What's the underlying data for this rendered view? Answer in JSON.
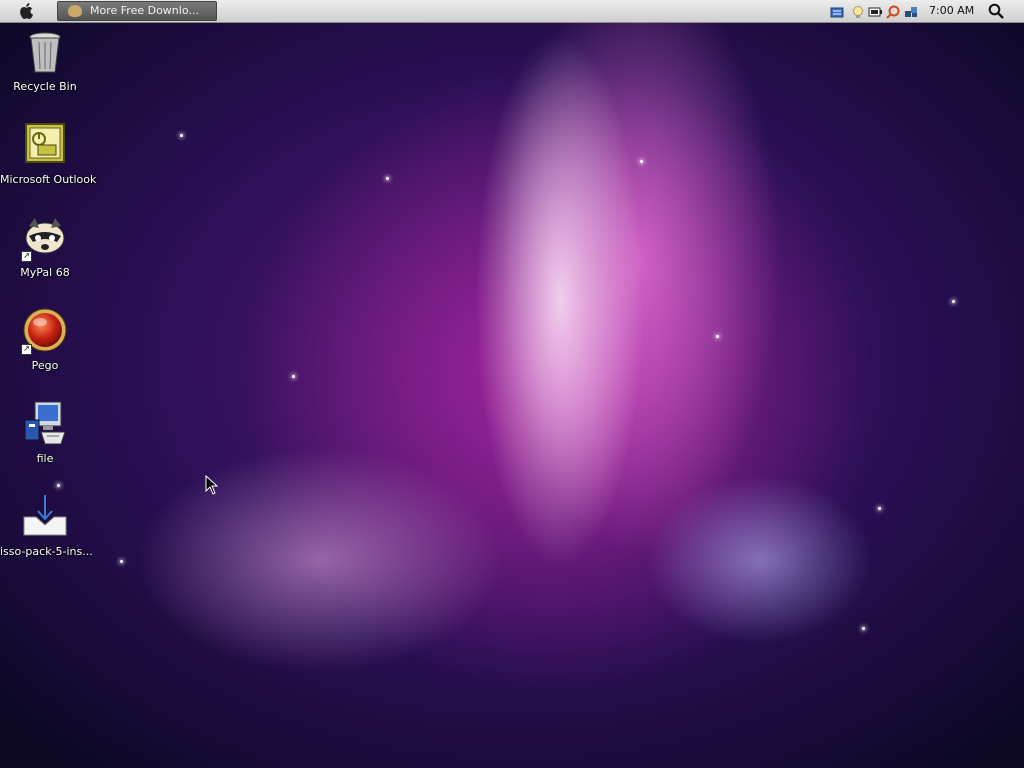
{
  "menubar": {
    "apple_icon": "apple-logo-icon",
    "task_button": {
      "label": "More Free Downlo...",
      "icon": "raccoon-icon"
    },
    "tray_icons": [
      "keyboard-icon",
      "lightbulb-icon",
      "battery-icon",
      "search-magnifier-icon",
      "network-icon"
    ],
    "clock": "7:00 AM",
    "spotlight_icon": "spotlight-search-icon"
  },
  "desktop_icons": [
    {
      "label": "Recycle Bin",
      "icon": "recycle-bin-icon"
    },
    {
      "label": "Microsoft Outlook",
      "icon": "outlook-icon"
    },
    {
      "label": "MyPal 68",
      "icon": "mypal-raccoon-icon"
    },
    {
      "label": "Pego",
      "icon": "pego-icon"
    },
    {
      "label": "file",
      "icon": "installer-file-icon"
    },
    {
      "label": "isso-pack-5-ins...",
      "icon": "download-package-icon"
    }
  ],
  "colors": {
    "menubar_top": "#ececec",
    "menubar_bottom": "#cfcfcf",
    "wallpaper_dark": "#0d0826",
    "wallpaper_magenta": "#c83cbe"
  }
}
